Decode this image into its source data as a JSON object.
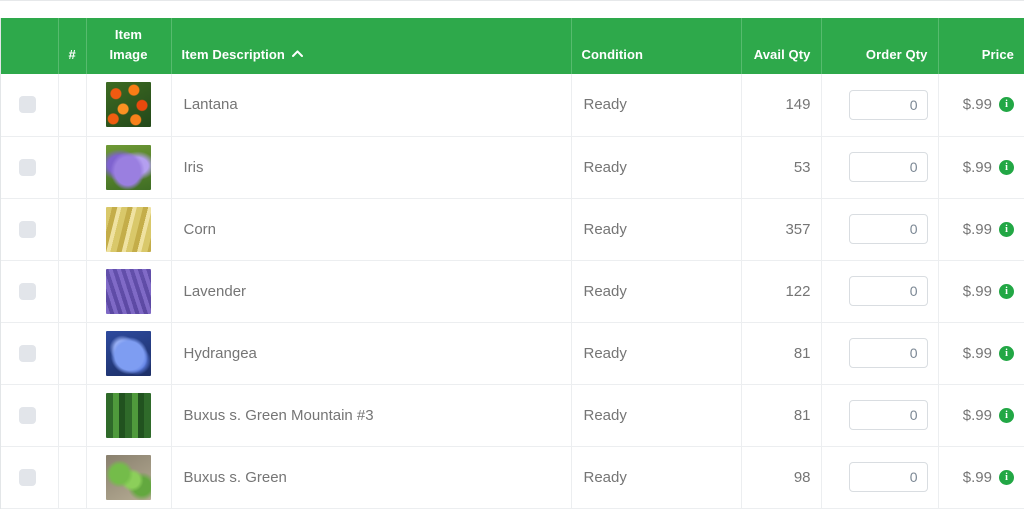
{
  "table": {
    "columns": [
      {
        "key": "select",
        "label": "",
        "align": "left"
      },
      {
        "key": "num",
        "label": "#",
        "align": "center"
      },
      {
        "key": "image",
        "label": "Item Image",
        "align": "center"
      },
      {
        "key": "description",
        "label": "Item Description",
        "align": "left",
        "sorted": "asc",
        "sort_icon": "chevron-up-icon"
      },
      {
        "key": "condition",
        "label": "Condition",
        "align": "left"
      },
      {
        "key": "avail_qty",
        "label": "Avail Qty",
        "align": "right"
      },
      {
        "key": "order_qty",
        "label": "Order Qty",
        "align": "right"
      },
      {
        "key": "price",
        "label": "Price",
        "align": "right"
      }
    ],
    "rows": [
      {
        "num": "",
        "image_alt": "lantana-thumbnail",
        "description": "Lantana",
        "condition": "Ready",
        "avail_qty": "149",
        "order_qty": "0",
        "price": "$.99",
        "info_icon": "info-icon",
        "checkbox_checked": false
      },
      {
        "num": "",
        "image_alt": "iris-thumbnail",
        "description": "Iris",
        "condition": "Ready",
        "avail_qty": "53",
        "order_qty": "0",
        "price": "$.99",
        "info_icon": "info-icon",
        "checkbox_checked": false
      },
      {
        "num": "",
        "image_alt": "corn-thumbnail",
        "description": "Corn",
        "condition": "Ready",
        "avail_qty": "357",
        "order_qty": "0",
        "price": "$.99",
        "info_icon": "info-icon",
        "checkbox_checked": false
      },
      {
        "num": "",
        "image_alt": "lavender-thumbnail",
        "description": "Lavender",
        "condition": "Ready",
        "avail_qty": "122",
        "order_qty": "0",
        "price": "$.99",
        "info_icon": "info-icon",
        "checkbox_checked": false
      },
      {
        "num": "",
        "image_alt": "hydrangea-thumbnail",
        "description": "Hydrangea",
        "condition": "Ready",
        "avail_qty": "81",
        "order_qty": "0",
        "price": "$.99",
        "info_icon": "info-icon",
        "checkbox_checked": false
      },
      {
        "num": "",
        "image_alt": "buxus-green-mountain-thumbnail",
        "description": "Buxus s. Green Mountain #3",
        "condition": "Ready",
        "avail_qty": "81",
        "order_qty": "0",
        "price": "$.99",
        "info_icon": "info-icon",
        "checkbox_checked": false
      },
      {
        "num": "",
        "image_alt": "buxus-green-thumbnail",
        "description": "Buxus s. Green",
        "condition": "Ready",
        "avail_qty": "98",
        "order_qty": "0",
        "price": "$.99",
        "info_icon": "info-icon",
        "checkbox_checked": false
      }
    ],
    "order_qty_placeholder": "0"
  },
  "colors": {
    "header_green": "#2ea94b",
    "header_text": "#ffffff",
    "body_text": "#757575",
    "row_border": "#eceef0",
    "checkbox_fill": "#e2e5ea",
    "info_badge": "#22a745",
    "input_border": "#d9dde1"
  }
}
